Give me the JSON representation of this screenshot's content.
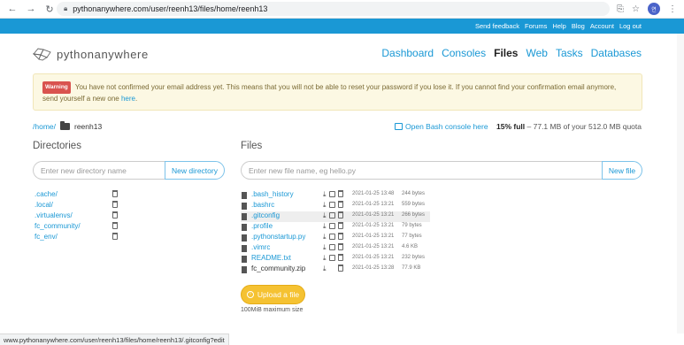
{
  "browser": {
    "url": "pythonanywhere.com/user/reenh13/files/home/reenh13",
    "avatar_text": "연",
    "status_url": "www.pythonanywhere.com/user/reenh13/files/home/reenh13/.gitconfig?edit"
  },
  "topbar": {
    "links": [
      "Send feedback",
      "Forums",
      "Help",
      "Blog",
      "Account",
      "Log out"
    ]
  },
  "header": {
    "logo_text": "pythonanywhere",
    "nav": [
      {
        "label": "Dashboard",
        "active": false
      },
      {
        "label": "Consoles",
        "active": false
      },
      {
        "label": "Files",
        "active": true
      },
      {
        "label": "Web",
        "active": false
      },
      {
        "label": "Tasks",
        "active": false
      },
      {
        "label": "Databases",
        "active": false
      }
    ]
  },
  "warning": {
    "label": "Warning",
    "text": "You have not confirmed your email address yet. This means that you will not be able to reset your password if you lose it. If you cannot find your confirmation email anymore, send yourself a new one",
    "link_text": "here",
    "after": "."
  },
  "breadcrumb": {
    "home": "/home/",
    "user": "reenh13"
  },
  "bash_link": "Open Bash console here",
  "quota": {
    "percent": "15% full",
    "detail": "– 77.1 MB of your 512.0 MB quota"
  },
  "directories": {
    "title": "Directories",
    "input_placeholder": "Enter new directory name",
    "button": "New directory",
    "items": [
      ".cache/",
      ".local/",
      ".virtualenvs/",
      "fc_community/",
      "fc_env/"
    ]
  },
  "files": {
    "title": "Files",
    "input_placeholder": "Enter new file name, eg hello.py",
    "button": "New file",
    "items": [
      {
        "name": ".bash_history",
        "date": "2021-01-25 13:48",
        "size": "244 bytes",
        "editable": true
      },
      {
        "name": ".bashrc",
        "date": "2021-01-25 13:21",
        "size": "559 bytes",
        "editable": true
      },
      {
        "name": ".gitconfig",
        "date": "2021-01-25 13:21",
        "size": "266 bytes",
        "editable": true
      },
      {
        "name": ".profile",
        "date": "2021-01-25 13:21",
        "size": "79 bytes",
        "editable": true
      },
      {
        "name": ".pythonstartup.py",
        "date": "2021-01-25 13:21",
        "size": "77 bytes",
        "editable": true
      },
      {
        "name": ".vimrc",
        "date": "2021-01-25 13:21",
        "size": "4.6 KB",
        "editable": true
      },
      {
        "name": "README.txt",
        "date": "2021-01-25 13:21",
        "size": "232 bytes",
        "editable": true
      },
      {
        "name": "fc_community.zip",
        "date": "2021-01-25 13:28",
        "size": "77.9 KB",
        "editable": false
      }
    ],
    "highlighted_index": 2,
    "upload_button": "Upload a file",
    "max_size": "100MiB maximum size"
  }
}
